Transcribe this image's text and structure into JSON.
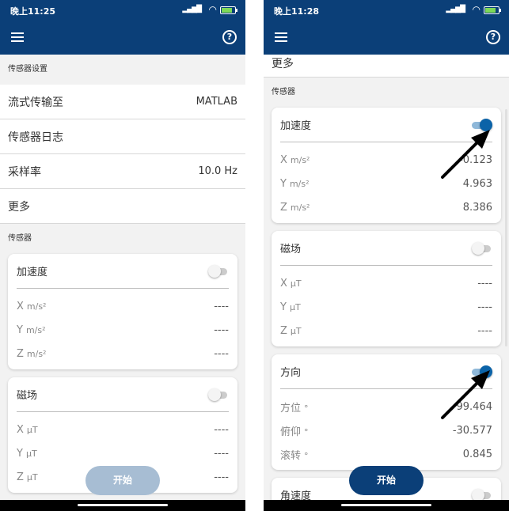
{
  "left": {
    "status_time": "晚上11:25",
    "settings_header": "传感器设置",
    "rows": [
      {
        "label": "流式传输至",
        "value": "MATLAB"
      },
      {
        "label": "传感器日志",
        "value": ""
      },
      {
        "label": "采样率",
        "value": "10.0 Hz"
      },
      {
        "label": "更多",
        "value": ""
      }
    ],
    "sensors_header": "传感器",
    "cards": [
      {
        "title": "加速度",
        "on": false,
        "rows": [
          {
            "axis": "X",
            "unit": "m/s²",
            "value": "----"
          },
          {
            "axis": "Y",
            "unit": "m/s²",
            "value": "----"
          },
          {
            "axis": "Z",
            "unit": "m/s²",
            "value": "----"
          }
        ]
      },
      {
        "title": "磁场",
        "on": false,
        "rows": [
          {
            "axis": "X",
            "unit": "μT",
            "value": "----"
          },
          {
            "axis": "Y",
            "unit": "μT",
            "value": "----"
          },
          {
            "axis": "Z",
            "unit": "μT",
            "value": "----"
          }
        ]
      }
    ],
    "start_label": "开始"
  },
  "right": {
    "status_time": "晚上11:28",
    "more_label": "更多",
    "sensors_header": "传感器",
    "cards": [
      {
        "title": "加速度",
        "on": true,
        "rows": [
          {
            "axis": "X",
            "unit": "m/s²",
            "value": "-0.123"
          },
          {
            "axis": "Y",
            "unit": "m/s²",
            "value": "4.963"
          },
          {
            "axis": "Z",
            "unit": "m/s²",
            "value": "8.386"
          }
        ]
      },
      {
        "title": "磁场",
        "on": false,
        "rows": [
          {
            "axis": "X",
            "unit": "μT",
            "value": "----"
          },
          {
            "axis": "Y",
            "unit": "μT",
            "value": "----"
          },
          {
            "axis": "Z",
            "unit": "μT",
            "value": "----"
          }
        ]
      },
      {
        "title": "方向",
        "on": true,
        "rows": [
          {
            "axis": "方位",
            "unit": "°",
            "value": "99.464"
          },
          {
            "axis": "俯仰",
            "unit": "°",
            "value": "-30.577"
          },
          {
            "axis": "滚转",
            "unit": "°",
            "value": "0.845"
          }
        ]
      },
      {
        "title": "角速度",
        "on": false,
        "rows": []
      }
    ],
    "start_label": "开始"
  },
  "icons": {
    "menu": "menu-icon",
    "help": "help-icon",
    "signal": "signal-icon",
    "wifi": "wifi-icon",
    "battery": "battery-icon",
    "annotation": "arrow-icon"
  },
  "colors": {
    "app_bar": "#0b3f78",
    "toggle_on": "#0b63a8",
    "start_disabled": "#a7bdd3",
    "start_enabled": "#0b3f78"
  }
}
